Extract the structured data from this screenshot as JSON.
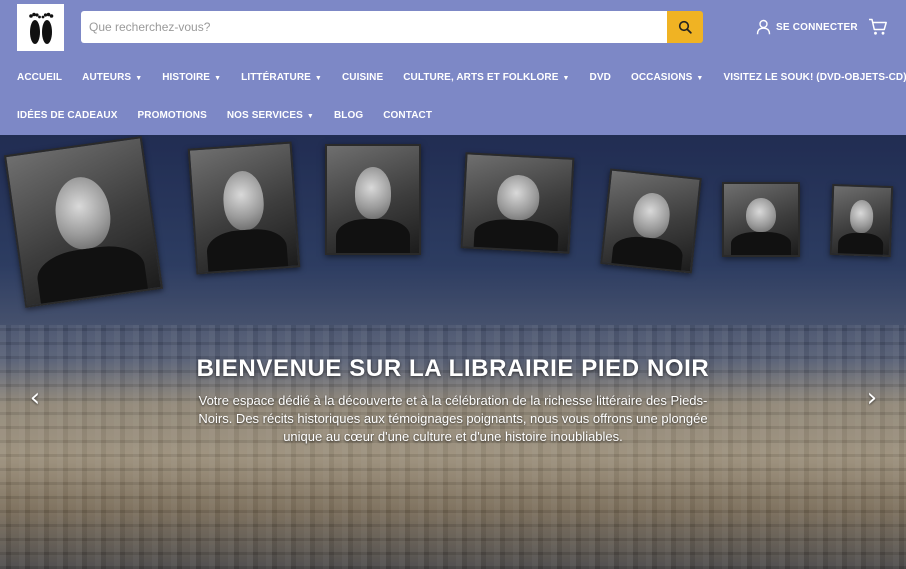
{
  "header": {
    "logo_icon": "footprints-icon",
    "search": {
      "placeholder": "Que recherchez-vous?",
      "value": "",
      "button_icon": "search-icon"
    },
    "login": {
      "label": "SE CONNECTER",
      "icon": "user-icon"
    },
    "cart": {
      "icon": "cart-icon"
    },
    "accent_color": "#f0b323",
    "bar_color": "#7d88c6"
  },
  "nav": {
    "row1": [
      {
        "label": "ACCUEIL",
        "dropdown": false
      },
      {
        "label": "AUTEURS",
        "dropdown": true
      },
      {
        "label": "HISTOIRE",
        "dropdown": true
      },
      {
        "label": "LITTÉRATURE",
        "dropdown": true
      },
      {
        "label": "CUISINE",
        "dropdown": false
      },
      {
        "label": "CULTURE, ARTS ET FOLKLORE",
        "dropdown": true
      },
      {
        "label": "DVD",
        "dropdown": false
      },
      {
        "label": "OCCASIONS",
        "dropdown": true
      },
      {
        "label": "VISITEZ LE SOUK! (DVD-OBJETS-CD)",
        "dropdown": false
      }
    ],
    "row2": [
      {
        "label": "IDÉES DE CADEAUX",
        "dropdown": false
      },
      {
        "label": "PROMOTIONS",
        "dropdown": false
      },
      {
        "label": "NOS SERVICES",
        "dropdown": true
      },
      {
        "label": "BLOG",
        "dropdown": false
      },
      {
        "label": "CONTACT",
        "dropdown": false
      }
    ],
    "caret_glyph": "▼"
  },
  "hero": {
    "title": "BIENVENUE SUR LA LIBRAIRIE PIED NOIR",
    "description": "Votre espace dédié à la découverte et à la célébration de la richesse littéraire des Pieds-Noirs. Des récits historiques aux témoignages poignants, nous vous offrons une plongée unique au cœur d'une culture et d'une histoire inoubliables.",
    "prev_glyph": "‹",
    "next_glyph": "›"
  }
}
